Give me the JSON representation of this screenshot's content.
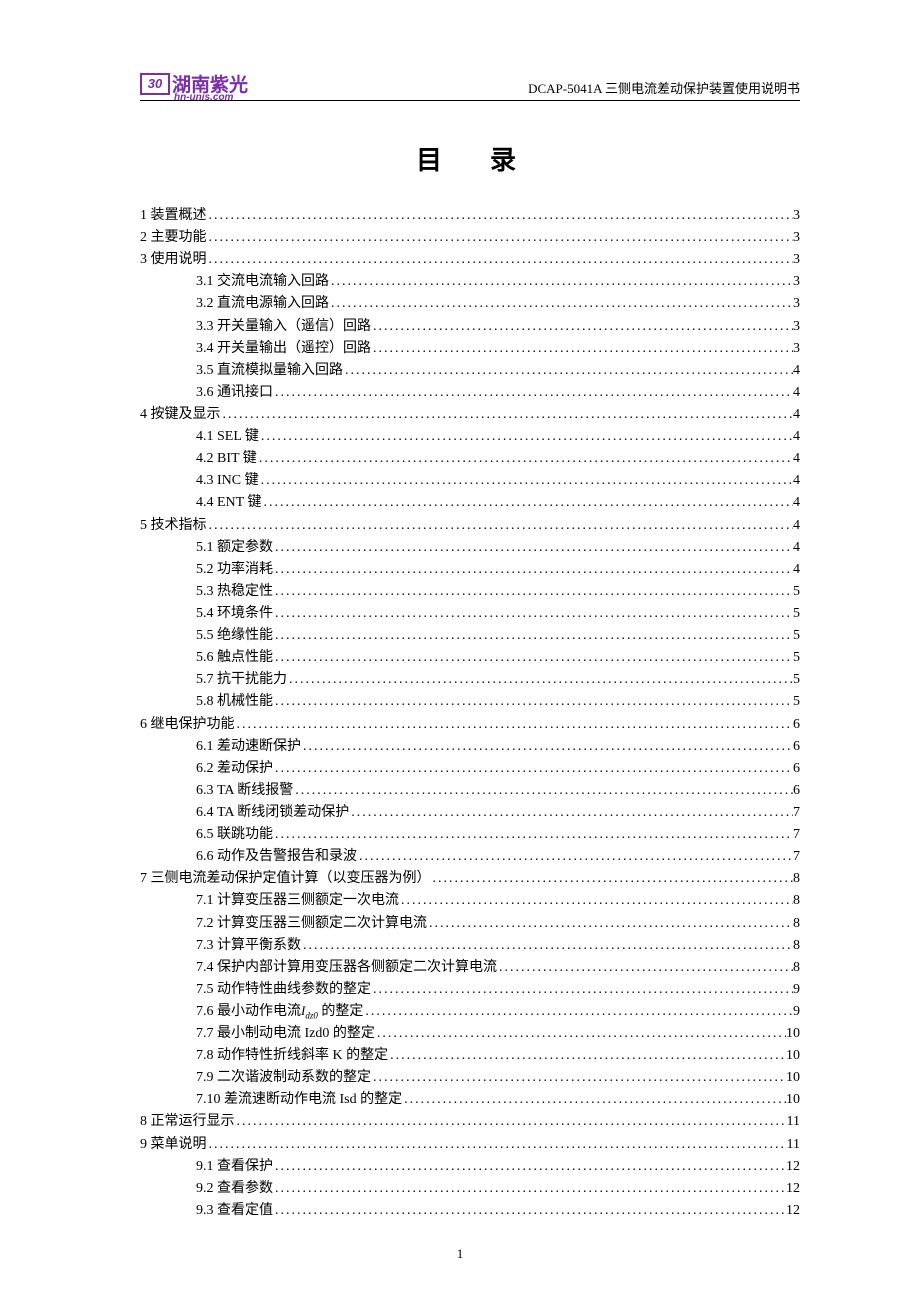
{
  "header": {
    "logo_mark": "30",
    "logo_cn": "湖南紫光",
    "logo_url": "hn-unis.com",
    "doc_title": "DCAP-5041A 三侧电流差动保护装置使用说明书"
  },
  "toc": {
    "title": "目录",
    "entries": [
      {
        "level": 1,
        "num": "1",
        "text": "装置概述",
        "page": "3"
      },
      {
        "level": 1,
        "num": "2",
        "text": "主要功能",
        "page": "3"
      },
      {
        "level": 1,
        "num": "3",
        "text": "使用说明",
        "page": "3"
      },
      {
        "level": 2,
        "num": "3.1",
        "text": "交流电流输入回路",
        "page": "3"
      },
      {
        "level": 2,
        "num": "3.2",
        "text": "直流电源输入回路",
        "page": "3"
      },
      {
        "level": 2,
        "num": "3.3",
        "text": "开关量输入（遥信）回路",
        "page": "3"
      },
      {
        "level": 2,
        "num": "3.4",
        "text": "开关量输出（遥控）回路",
        "page": "3"
      },
      {
        "level": 2,
        "num": "3.5",
        "text": "直流模拟量输入回路",
        "page": "4"
      },
      {
        "level": 2,
        "num": "3.6",
        "text": "通讯接口",
        "page": "4"
      },
      {
        "level": 1,
        "num": "4",
        "text": "按键及显示",
        "page": "4"
      },
      {
        "level": 2,
        "num": "4.1",
        "text": "SEL 键",
        "page": "4"
      },
      {
        "level": 2,
        "num": "4.2",
        "text": "BIT 键",
        "page": "4"
      },
      {
        "level": 2,
        "num": "4.3",
        "text": "INC 键",
        "page": "4"
      },
      {
        "level": 2,
        "num": "4.4",
        "text": "ENT 键",
        "page": "4"
      },
      {
        "level": 1,
        "num": "5",
        "text": "技术指标",
        "page": "4"
      },
      {
        "level": 2,
        "num": "5.1",
        "text": "额定参数",
        "page": "4"
      },
      {
        "level": 2,
        "num": "5.2",
        "text": "功率消耗",
        "page": "4"
      },
      {
        "level": 2,
        "num": "5.3",
        "text": "热稳定性",
        "page": "5"
      },
      {
        "level": 2,
        "num": "5.4",
        "text": "环境条件",
        "page": "5"
      },
      {
        "level": 2,
        "num": "5.5",
        "text": "绝缘性能",
        "page": "5"
      },
      {
        "level": 2,
        "num": "5.6",
        "text": "触点性能",
        "page": "5"
      },
      {
        "level": 2,
        "num": "5.7",
        "text": "抗干扰能力",
        "page": "5"
      },
      {
        "level": 2,
        "num": "5.8",
        "text": "机械性能",
        "page": "5"
      },
      {
        "level": 1,
        "num": "6",
        "text": "继电保护功能",
        "page": "6"
      },
      {
        "level": 2,
        "num": "6.1",
        "text": "差动速断保护",
        "page": "6"
      },
      {
        "level": 2,
        "num": "6.2",
        "text": "差动保护",
        "page": "6"
      },
      {
        "level": 2,
        "num": "6.3",
        "text": "TA 断线报警",
        "page": "6"
      },
      {
        "level": 2,
        "num": "6.4",
        "text": "TA 断线闭锁差动保护",
        "page": "7"
      },
      {
        "level": 2,
        "num": "6.5",
        "text": "联跳功能",
        "page": "7"
      },
      {
        "level": 2,
        "num": "6.6",
        "text": "动作及告警报告和录波",
        "page": "7"
      },
      {
        "level": 1,
        "num": "7",
        "text": "三侧电流差动保护定值计算（以变压器为例）",
        "page": "8"
      },
      {
        "level": 2,
        "num": "7.1",
        "text": "计算变压器三侧额定一次电流",
        "page": "8"
      },
      {
        "level": 2,
        "num": "7.2",
        "text": "计算变压器三侧额定二次计算电流",
        "page": "8"
      },
      {
        "level": 2,
        "num": "7.3",
        "text": "计算平衡系数",
        "page": "8"
      },
      {
        "level": 2,
        "num": "7.4",
        "text": "保护内部计算用变压器各侧额定二次计算电流",
        "page": "8"
      },
      {
        "level": 2,
        "num": "7.5",
        "text": "动作特性曲线参数的整定",
        "page": "9"
      },
      {
        "level": 2,
        "num": "7.6",
        "text": "最小动作电流",
        "special": "Idz0",
        "suffix": "的整定",
        "page": "9"
      },
      {
        "level": 2,
        "num": "7.7",
        "text": "最小制动电流 Izd0 的整定",
        "page": "10"
      },
      {
        "level": 2,
        "num": "7.8",
        "text": "动作特性折线斜率 K 的整定",
        "page": "10"
      },
      {
        "level": 2,
        "num": "7.9",
        "text": "二次谐波制动系数的整定",
        "page": "10"
      },
      {
        "level": 2,
        "num": "7.10",
        "text": "差流速断动作电流 Isd 的整定",
        "page": "10"
      },
      {
        "level": 1,
        "num": "8",
        "text": "正常运行显示",
        "page": "11"
      },
      {
        "level": 1,
        "num": "9",
        "text": "菜单说明",
        "page": "11"
      },
      {
        "level": 2,
        "num": "9.1",
        "text": "查看保护",
        "page": "12"
      },
      {
        "level": 2,
        "num": "9.2",
        "text": "查看参数",
        "page": "12"
      },
      {
        "level": 2,
        "num": "9.3",
        "text": "查看定值",
        "page": "12"
      }
    ]
  },
  "page_number": "1"
}
